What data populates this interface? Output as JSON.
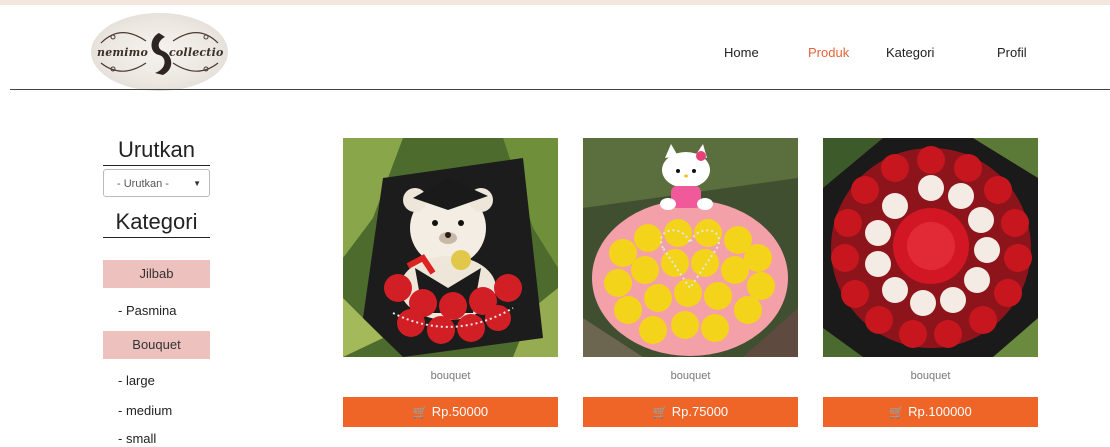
{
  "brand": {
    "logo_left_text": "nemimo",
    "logo_right_text": "collectio"
  },
  "nav": {
    "items": [
      {
        "label": "Home",
        "active": false
      },
      {
        "label": "Produk",
        "active": true
      },
      {
        "label": "Kategori",
        "active": false
      },
      {
        "label": "Profil",
        "active": false
      }
    ]
  },
  "sidebar": {
    "sort_title": "Urutkan",
    "sort_select": {
      "selected": "- Urutkan -"
    },
    "category_title": "Kategori",
    "categories": [
      {
        "label": "Jilbab",
        "items": [
          "- Pasmina"
        ]
      },
      {
        "label": "Bouquet",
        "items": [
          "- large",
          "- medium",
          "- small"
        ]
      }
    ]
  },
  "products": [
    {
      "category": "bouquet",
      "price": "Rp.50000",
      "image": "teddy-bear-red-roses-bouquet"
    },
    {
      "category": "bouquet",
      "price": "Rp.75000",
      "image": "hello-kitty-yellow-roses-bouquet"
    },
    {
      "category": "bouquet",
      "price": "Rp.100000",
      "image": "red-white-roses-bouquet"
    }
  ],
  "colors": {
    "accent": "#e5643a",
    "button": "#ef6427",
    "category_button": "#edc1bd"
  }
}
